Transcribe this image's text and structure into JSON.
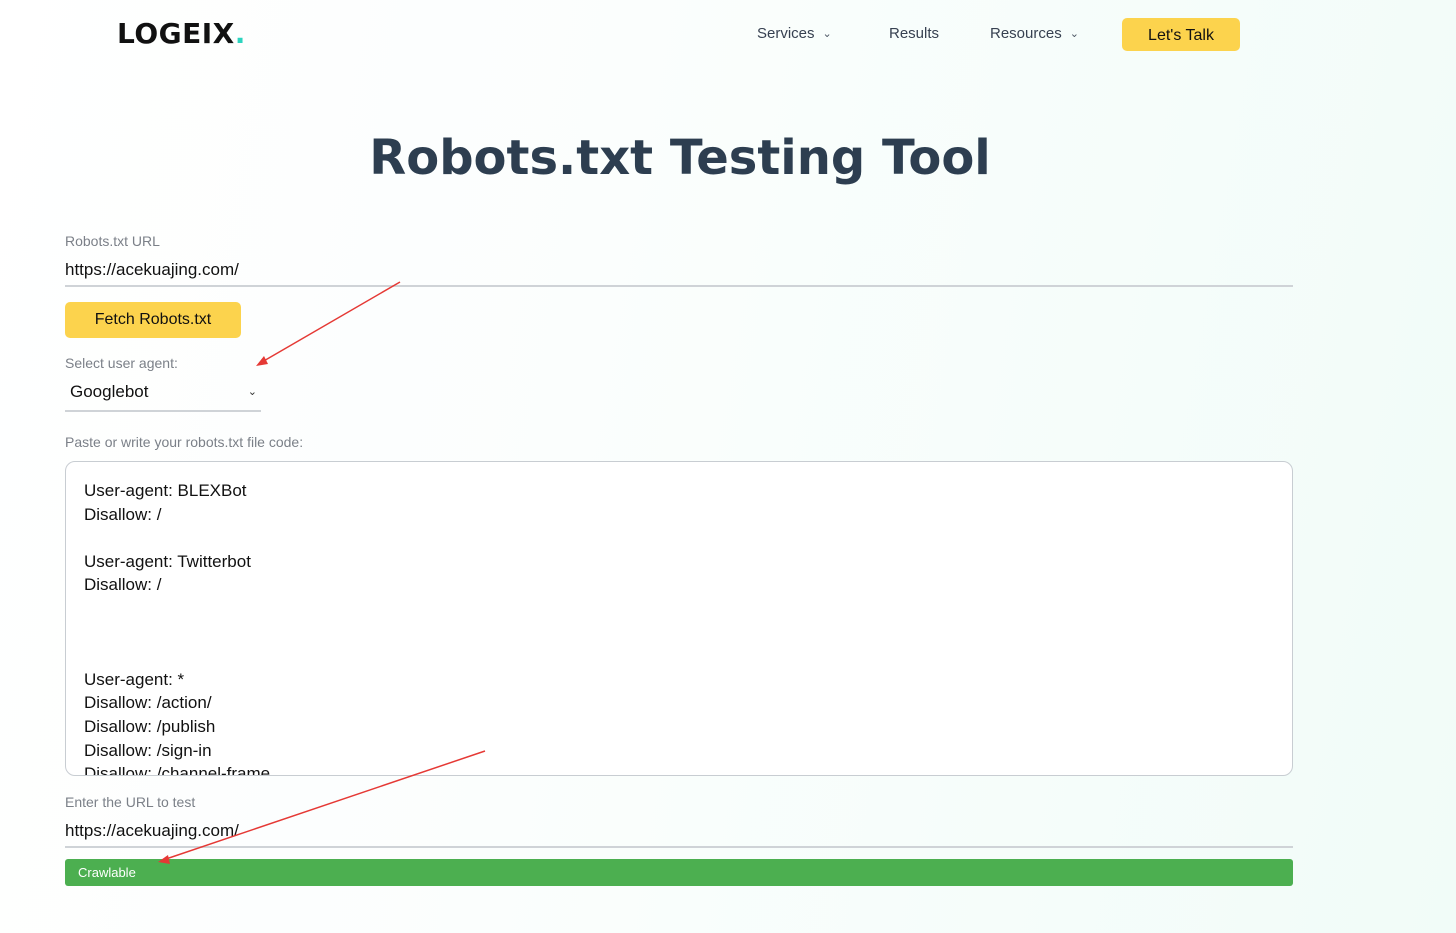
{
  "header": {
    "logo_text": "LOGEIX",
    "logo_dot": ".",
    "nav": [
      {
        "label": "Services",
        "has_dropdown": true
      },
      {
        "label": "Results",
        "has_dropdown": false
      },
      {
        "label": "Resources",
        "has_dropdown": true
      }
    ],
    "cta_label": "Let's Talk"
  },
  "main": {
    "title": "Robots.txt Testing Tool",
    "robots_url": {
      "label": "Robots.txt URL",
      "value": "https://acekuajing.com/"
    },
    "fetch_button_label": "Fetch Robots.txt",
    "user_agent": {
      "label": "Select user agent:",
      "selected": "Googlebot"
    },
    "code": {
      "label": "Paste or write your robots.txt file code:",
      "lines": [
        "User-agent: BLEXBot",
        "Disallow: /",
        "",
        "User-agent: Twitterbot",
        "Disallow: /",
        "",
        "",
        "",
        "User-agent: *",
        "Disallow: /action/",
        "Disallow: /publish",
        "Disallow: /sign-in",
        "Disallow: /channel-frame"
      ]
    },
    "test_url": {
      "label": "Enter the URL to test",
      "value": "https://acekuajing.com/"
    },
    "result": {
      "label": "Crawlable",
      "color": "#4caf50"
    }
  },
  "colors": {
    "accent_yellow": "#fcd34d",
    "title": "#2d3e50",
    "logo_dot": "#2dd4bf",
    "annotation_arrow": "#e53935"
  },
  "icons": {
    "dropdown": "chevron-down-icon"
  }
}
